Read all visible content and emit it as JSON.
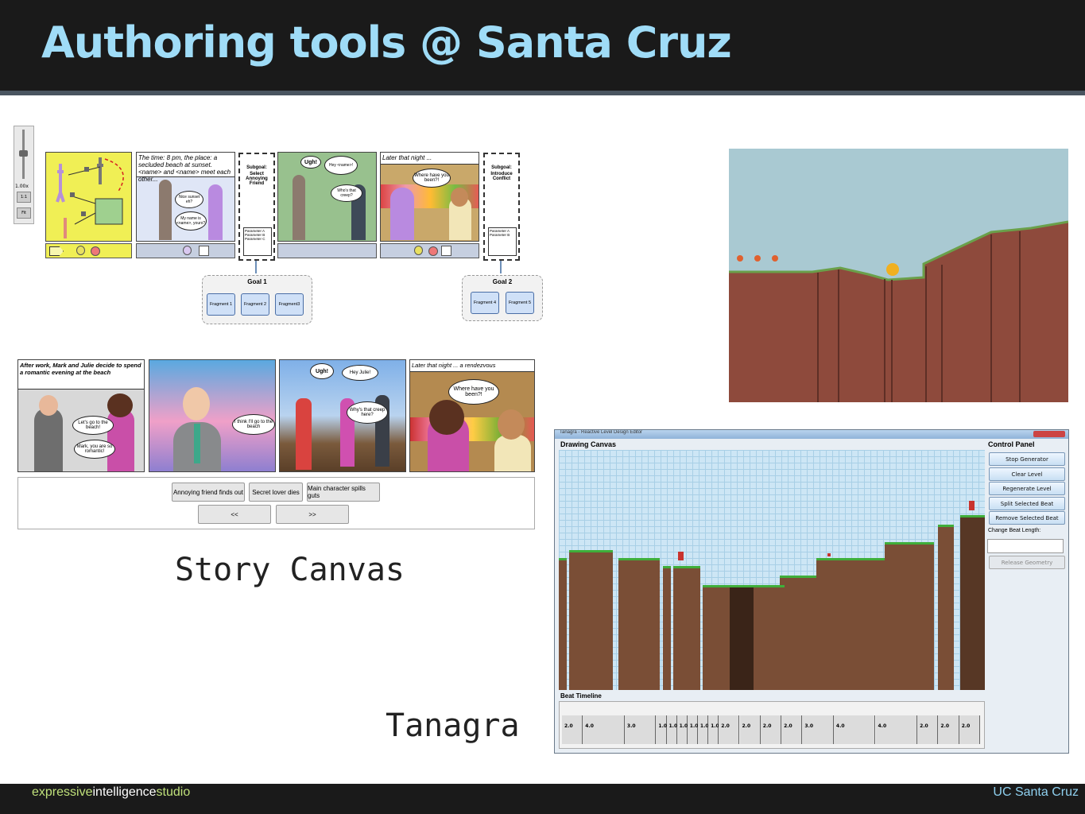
{
  "slide": {
    "title": "Authoring tools @ Santa Cruz",
    "footer": {
      "expressive": "expressive",
      "intelligence": "intelligence",
      "studio": "studio",
      "right": "UC Santa Cruz"
    },
    "colors": {
      "title": "#9fdcf7",
      "footer_light": "#8fd0ef",
      "footer_green": "#bfe07a",
      "bar": "#1a1a1a"
    }
  },
  "story_canvas": {
    "caption": "Story Canvas",
    "zoom": {
      "level": "1.00x",
      "one_to_one": "1:1",
      "fit": "Fit"
    },
    "top_row": {
      "panel2_text": "The time: 8 pm, the place: a secluded beach at sunset. <name> and <name> meet each other...",
      "bubble_nice_sunset": "Nice sunset eh?",
      "bubble_my_name": "My name is <name>, yours?",
      "subgoal1": {
        "title": "Subgoal:",
        "name": "Select Annoying Friend"
      },
      "panel4_ugh": "Ugh!",
      "panel4_hey": "Hey <name>!",
      "panel4_whos": "Who's that creep?",
      "panel5_text": "Later that night ...",
      "panel5_bubble": "Where have you been?!",
      "subgoal2": {
        "title": "Subgoal:",
        "name": "Introduce Conflict"
      },
      "params": [
        "Parameter A",
        "Parameter B",
        "Parameter C"
      ],
      "params2": [
        "Parameter A",
        "Parameter B"
      ]
    },
    "goal1": {
      "label": "Goal 1",
      "fragments": [
        "Fragment 1",
        "Fragment 2",
        "Fragment3"
      ]
    },
    "goal2": {
      "label": "Goal 2",
      "fragments": [
        "Fragment 4",
        "Fragment 5"
      ]
    },
    "comic": {
      "p1_text": "After work, Mark and Julie decide to spend a romantic evening at the beach",
      "p1_b1": "Let's go to the beach!",
      "p1_b2": "Mark, you are so romantic!",
      "p2_b1": "I think I'll go to the beach",
      "p3_ugh": "Ugh!",
      "p3_hey": "Hey Julie!",
      "p3_whys": "Why's that creep here?",
      "p4_text": "Later that night ... a rendezvous",
      "p4_bubble": "Where have you been?!"
    },
    "choices": [
      "Annoying friend finds out",
      "Secret lover dies",
      "Main character spills guts"
    ],
    "nav": {
      "prev": "<<",
      "next": ">>"
    }
  },
  "tanagra": {
    "caption": "Tanagra",
    "window_title": "Tanagra - Reactive Level Design Editor",
    "drawing_canvas": "Drawing Canvas",
    "control_panel": "Control Panel",
    "buttons": [
      "Stop Generator",
      "Clear Level",
      "Regenerate Level",
      "Split Selected Beat",
      "Remove Selected Beat"
    ],
    "beat_length_label": "Change Beat Length:",
    "beat_length_value": "",
    "release_geometry": "Release Geometry",
    "beat_timeline": "Beat Timeline",
    "beats": [
      "2.0",
      "4.0",
      "3.0",
      "1.0",
      "1.0",
      "1.0",
      "1.0",
      "1.0",
      "1.0",
      "2.0",
      "2.0",
      "2.0",
      "2.0",
      "3.0",
      "4.0",
      "4.0",
      "2.0",
      "2.0",
      "2.0"
    ]
  }
}
